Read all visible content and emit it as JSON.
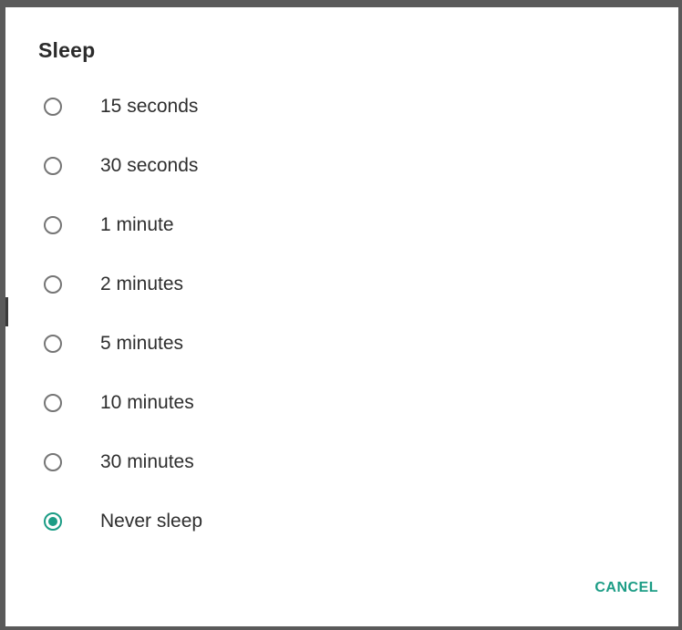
{
  "dialog": {
    "title": "Sleep",
    "options": [
      {
        "label": "15 seconds",
        "selected": false
      },
      {
        "label": "30 seconds",
        "selected": false
      },
      {
        "label": "1 minute",
        "selected": false
      },
      {
        "label": "2 minutes",
        "selected": false
      },
      {
        "label": "5 minutes",
        "selected": false
      },
      {
        "label": "10 minutes",
        "selected": false
      },
      {
        "label": "30 minutes",
        "selected": false
      },
      {
        "label": "Never sleep",
        "selected": true
      }
    ],
    "cancel_label": "CANCEL"
  },
  "colors": {
    "accent": "#1b9c85",
    "radio_unchecked": "#757575",
    "text": "#2e2e2e",
    "border": "#5a5a5a"
  }
}
